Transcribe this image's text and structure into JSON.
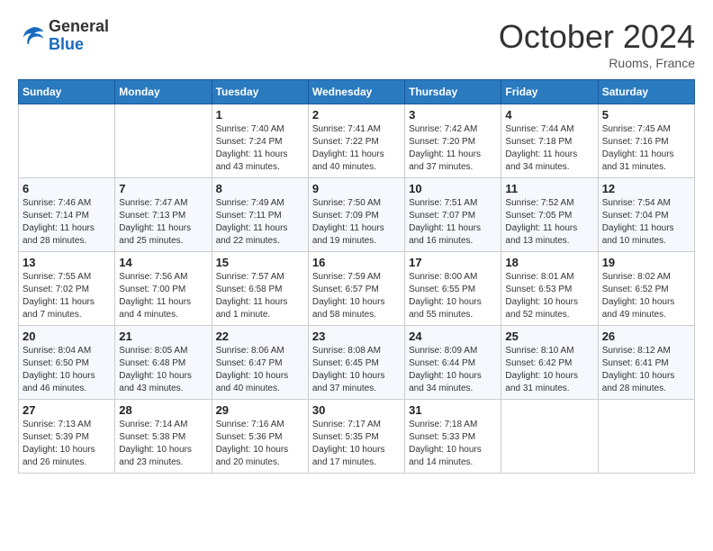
{
  "header": {
    "logo": {
      "general": "General",
      "blue": "Blue"
    },
    "title": "October 2024",
    "location": "Ruoms, France"
  },
  "weekdays": [
    "Sunday",
    "Monday",
    "Tuesday",
    "Wednesday",
    "Thursday",
    "Friday",
    "Saturday"
  ],
  "weeks": [
    [
      {
        "day": "",
        "info": ""
      },
      {
        "day": "",
        "info": ""
      },
      {
        "day": "1",
        "info": "Sunrise: 7:40 AM\nSunset: 7:24 PM\nDaylight: 11 hours and 43 minutes."
      },
      {
        "day": "2",
        "info": "Sunrise: 7:41 AM\nSunset: 7:22 PM\nDaylight: 11 hours and 40 minutes."
      },
      {
        "day": "3",
        "info": "Sunrise: 7:42 AM\nSunset: 7:20 PM\nDaylight: 11 hours and 37 minutes."
      },
      {
        "day": "4",
        "info": "Sunrise: 7:44 AM\nSunset: 7:18 PM\nDaylight: 11 hours and 34 minutes."
      },
      {
        "day": "5",
        "info": "Sunrise: 7:45 AM\nSunset: 7:16 PM\nDaylight: 11 hours and 31 minutes."
      }
    ],
    [
      {
        "day": "6",
        "info": "Sunrise: 7:46 AM\nSunset: 7:14 PM\nDaylight: 11 hours and 28 minutes."
      },
      {
        "day": "7",
        "info": "Sunrise: 7:47 AM\nSunset: 7:13 PM\nDaylight: 11 hours and 25 minutes."
      },
      {
        "day": "8",
        "info": "Sunrise: 7:49 AM\nSunset: 7:11 PM\nDaylight: 11 hours and 22 minutes."
      },
      {
        "day": "9",
        "info": "Sunrise: 7:50 AM\nSunset: 7:09 PM\nDaylight: 11 hours and 19 minutes."
      },
      {
        "day": "10",
        "info": "Sunrise: 7:51 AM\nSunset: 7:07 PM\nDaylight: 11 hours and 16 minutes."
      },
      {
        "day": "11",
        "info": "Sunrise: 7:52 AM\nSunset: 7:05 PM\nDaylight: 11 hours and 13 minutes."
      },
      {
        "day": "12",
        "info": "Sunrise: 7:54 AM\nSunset: 7:04 PM\nDaylight: 11 hours and 10 minutes."
      }
    ],
    [
      {
        "day": "13",
        "info": "Sunrise: 7:55 AM\nSunset: 7:02 PM\nDaylight: 11 hours and 7 minutes."
      },
      {
        "day": "14",
        "info": "Sunrise: 7:56 AM\nSunset: 7:00 PM\nDaylight: 11 hours and 4 minutes."
      },
      {
        "day": "15",
        "info": "Sunrise: 7:57 AM\nSunset: 6:58 PM\nDaylight: 11 hours and 1 minute."
      },
      {
        "day": "16",
        "info": "Sunrise: 7:59 AM\nSunset: 6:57 PM\nDaylight: 10 hours and 58 minutes."
      },
      {
        "day": "17",
        "info": "Sunrise: 8:00 AM\nSunset: 6:55 PM\nDaylight: 10 hours and 55 minutes."
      },
      {
        "day": "18",
        "info": "Sunrise: 8:01 AM\nSunset: 6:53 PM\nDaylight: 10 hours and 52 minutes."
      },
      {
        "day": "19",
        "info": "Sunrise: 8:02 AM\nSunset: 6:52 PM\nDaylight: 10 hours and 49 minutes."
      }
    ],
    [
      {
        "day": "20",
        "info": "Sunrise: 8:04 AM\nSunset: 6:50 PM\nDaylight: 10 hours and 46 minutes."
      },
      {
        "day": "21",
        "info": "Sunrise: 8:05 AM\nSunset: 6:48 PM\nDaylight: 10 hours and 43 minutes."
      },
      {
        "day": "22",
        "info": "Sunrise: 8:06 AM\nSunset: 6:47 PM\nDaylight: 10 hours and 40 minutes."
      },
      {
        "day": "23",
        "info": "Sunrise: 8:08 AM\nSunset: 6:45 PM\nDaylight: 10 hours and 37 minutes."
      },
      {
        "day": "24",
        "info": "Sunrise: 8:09 AM\nSunset: 6:44 PM\nDaylight: 10 hours and 34 minutes."
      },
      {
        "day": "25",
        "info": "Sunrise: 8:10 AM\nSunset: 6:42 PM\nDaylight: 10 hours and 31 minutes."
      },
      {
        "day": "26",
        "info": "Sunrise: 8:12 AM\nSunset: 6:41 PM\nDaylight: 10 hours and 28 minutes."
      }
    ],
    [
      {
        "day": "27",
        "info": "Sunrise: 7:13 AM\nSunset: 5:39 PM\nDaylight: 10 hours and 26 minutes."
      },
      {
        "day": "28",
        "info": "Sunrise: 7:14 AM\nSunset: 5:38 PM\nDaylight: 10 hours and 23 minutes."
      },
      {
        "day": "29",
        "info": "Sunrise: 7:16 AM\nSunset: 5:36 PM\nDaylight: 10 hours and 20 minutes."
      },
      {
        "day": "30",
        "info": "Sunrise: 7:17 AM\nSunset: 5:35 PM\nDaylight: 10 hours and 17 minutes."
      },
      {
        "day": "31",
        "info": "Sunrise: 7:18 AM\nSunset: 5:33 PM\nDaylight: 10 hours and 14 minutes."
      },
      {
        "day": "",
        "info": ""
      },
      {
        "day": "",
        "info": ""
      }
    ]
  ]
}
